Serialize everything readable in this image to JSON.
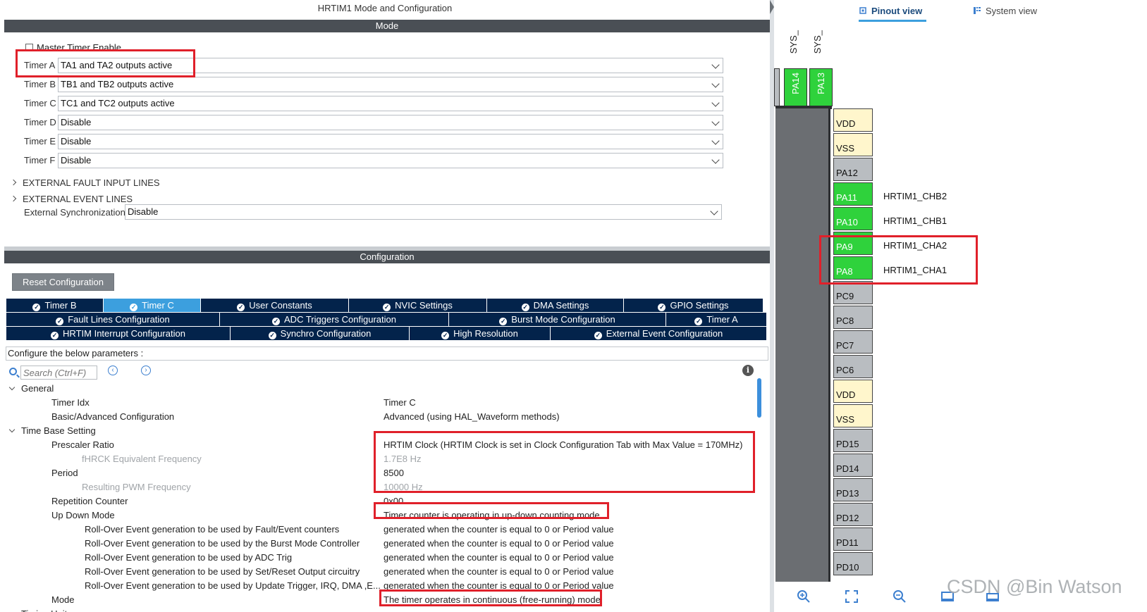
{
  "window_title": "HRTIM1 Mode and Configuration",
  "mode_header": "Mode",
  "config_header": "Configuration",
  "master_timer": {
    "label": "Master Timer Enable",
    "checked": false
  },
  "timers": [
    {
      "label": "Timer A",
      "value": "TA1 and TA2 outputs active"
    },
    {
      "label": "Timer B",
      "value": "TB1 and TB2 outputs active"
    },
    {
      "label": "Timer C",
      "value": "TC1 and TC2 outputs active"
    },
    {
      "label": "Timer D",
      "value": "Disable"
    },
    {
      "label": "Timer E",
      "value": "Disable"
    },
    {
      "label": "Timer F",
      "value": "Disable"
    }
  ],
  "expanders": [
    "EXTERNAL FAULT INPUT LINES",
    "EXTERNAL EVENT LINES"
  ],
  "ext_sync": {
    "label": "External Synchronization",
    "value": "Disable"
  },
  "reset_button": "Reset Configuration",
  "tabs_row1": [
    "Timer B",
    "Timer C",
    "User Constants",
    "NVIC Settings",
    "DMA Settings",
    "GPIO Settings"
  ],
  "tabs_row2": [
    "Fault Lines Configuration",
    "ADC Triggers Configuration",
    "Burst Mode Configuration",
    "Timer A"
  ],
  "tabs_row3": [
    "HRTIM Interrupt Configuration",
    "Synchro Configuration",
    "High Resolution",
    "External Event Configuration"
  ],
  "active_tab": "Timer C",
  "config_hint": "Configure the below parameters :",
  "search": {
    "placeholder": "Search (Ctrl+F)"
  },
  "params": [
    {
      "name": "General",
      "value": "",
      "type": "group"
    },
    {
      "name": "Timer Idx",
      "value": "Timer C",
      "type": "param"
    },
    {
      "name": "Basic/Advanced Configuration",
      "value": "Advanced (using HAL_Waveform methods)",
      "type": "param"
    },
    {
      "name": "Time Base Setting",
      "value": "",
      "type": "group"
    },
    {
      "name": "Prescaler Ratio",
      "value": "HRTIM Clock (HRTIM Clock is set in Clock Configuration Tab with Max Value = 170MHz)",
      "type": "param"
    },
    {
      "name": "fHRCK Equivalent Frequency",
      "value": "1.7E8 Hz",
      "type": "sub-dim"
    },
    {
      "name": "Period",
      "value": "8500",
      "type": "param"
    },
    {
      "name": "Resulting PWM Frequency",
      "value": "10000 Hz",
      "type": "sub-dim"
    },
    {
      "name": "Repetition Counter",
      "value": "0x00",
      "type": "param"
    },
    {
      "name": "Up Down Mode",
      "value": "Timer counter is operating in up-down counting mode",
      "type": "param"
    },
    {
      "name": "Roll-Over Event generation to be used by Fault/Event counters",
      "value": "generated when the counter is equal to 0 or Period value",
      "type": "sub"
    },
    {
      "name": "Roll-Over Event generation to be used by the Burst Mode Controller",
      "value": "generated when the counter is equal to 0 or Period value",
      "type": "sub"
    },
    {
      "name": "Roll-Over Event generation to be used by  ADC Trig",
      "value": "generated when the counter is equal to 0 or Period value",
      "type": "sub"
    },
    {
      "name": "Roll-Over Event generation to be used by Set/Reset Output circuitry",
      "value": "generated when the counter is equal to 0 or Period value",
      "type": "sub"
    },
    {
      "name": "Roll-Over Event generation to be used by Update Trigger, IRQ, DMA ,E...",
      "value": "generated when the counter is equal to 0 or Period value",
      "type": "sub"
    },
    {
      "name": "Mode",
      "value": "The timer operates in continuous (free-running) mode",
      "type": "param"
    },
    {
      "name": "Timing Unit",
      "value": "",
      "type": "group"
    }
  ],
  "view_tabs": {
    "pinout": "Pinout view",
    "system": "System view"
  },
  "sys_labels": [
    "SYS_",
    "SYS_"
  ],
  "top_pins": [
    "PA14",
    "PA13"
  ],
  "pins": [
    {
      "name": "VDD",
      "color": "yellow",
      "signal": ""
    },
    {
      "name": "VSS",
      "color": "yellow",
      "signal": ""
    },
    {
      "name": "PA12",
      "color": "gray",
      "signal": ""
    },
    {
      "name": "PA11",
      "color": "green",
      "signal": "HRTIM1_CHB2"
    },
    {
      "name": "PA10",
      "color": "green",
      "signal": "HRTIM1_CHB1"
    },
    {
      "name": "PA9",
      "color": "green",
      "signal": "HRTIM1_CHA2"
    },
    {
      "name": "PA8",
      "color": "green",
      "signal": "HRTIM1_CHA1"
    },
    {
      "name": "PC9",
      "color": "gray",
      "signal": ""
    },
    {
      "name": "PC8",
      "color": "gray",
      "signal": ""
    },
    {
      "name": "PC7",
      "color": "gray",
      "signal": ""
    },
    {
      "name": "PC6",
      "color": "gray",
      "signal": ""
    },
    {
      "name": "VDD",
      "color": "yellow",
      "signal": ""
    },
    {
      "name": "VSS",
      "color": "yellow",
      "signal": ""
    },
    {
      "name": "PD15",
      "color": "gray",
      "signal": ""
    },
    {
      "name": "PD14",
      "color": "gray",
      "signal": ""
    },
    {
      "name": "PD13",
      "color": "gray",
      "signal": ""
    },
    {
      "name": "PD12",
      "color": "gray",
      "signal": ""
    },
    {
      "name": "PD11",
      "color": "gray",
      "signal": ""
    },
    {
      "name": "PD10",
      "color": "gray",
      "signal": ""
    }
  ],
  "watermark": "CSDN @Bin Watson",
  "colors": {
    "tab_bg": "#03234b",
    "tab_active": "#3c9fde",
    "pin_green": "#2fd23c",
    "highlight": "#e0202a"
  }
}
